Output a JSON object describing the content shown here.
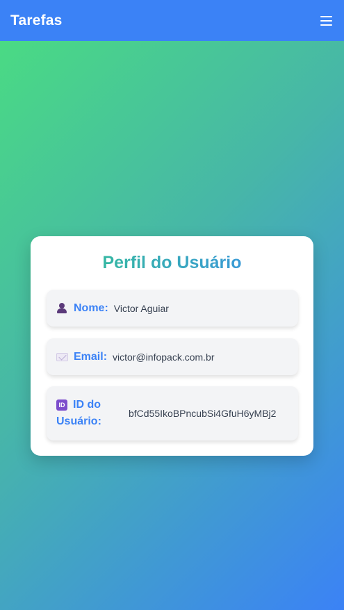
{
  "navbar": {
    "brand": "Tarefas",
    "menu_icon": "hamburger-menu-icon"
  },
  "profile": {
    "title": "Perfil do Usuário",
    "fields": {
      "name": {
        "icon": "person-icon",
        "label": "Nome:",
        "value": "Victor Aguiar"
      },
      "email": {
        "icon": "envelope-icon",
        "label": "Email:",
        "value": "victor@infopack.com.br"
      },
      "id": {
        "icon": "id-icon",
        "icon_text": "ID",
        "label_line1": "ID do",
        "label_line2": "Usuário:",
        "value": "bfCd55IkoBPncubSi4GfuH6yMBj2"
      }
    }
  },
  "colors": {
    "navbar": "#3b82f6",
    "label": "#3b82f6",
    "gradient_start": "#4ade80",
    "gradient_end": "#3b82f6"
  }
}
